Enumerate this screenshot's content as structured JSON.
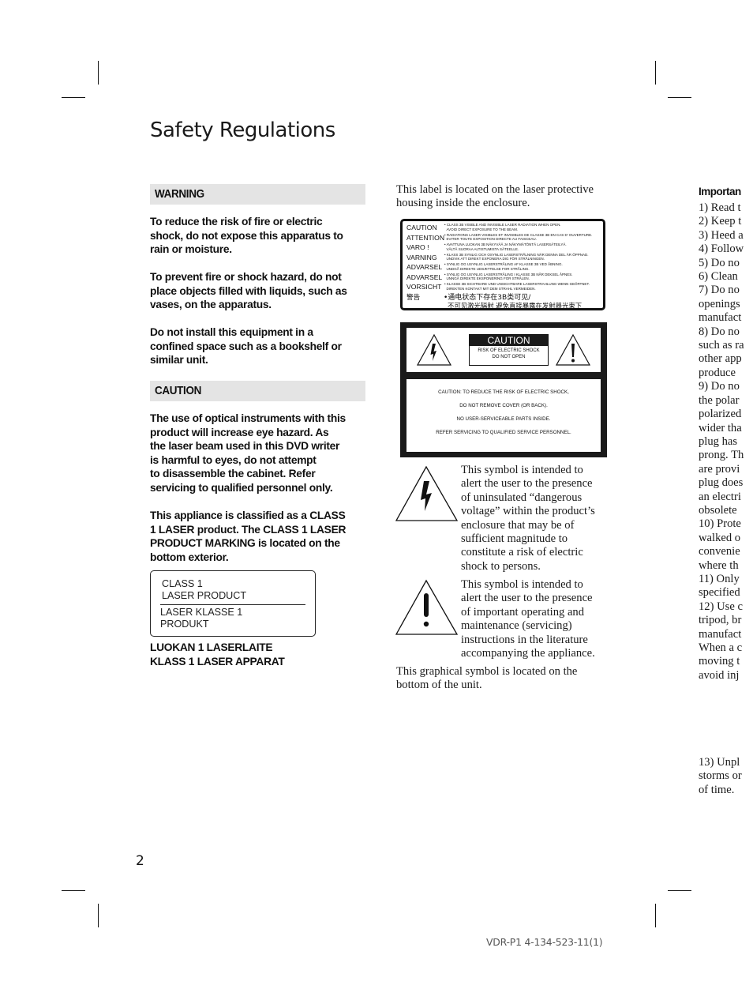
{
  "page": {
    "title": "Safety Regulations",
    "page_number": "2",
    "doc_code": "VDR-P1 4-134-523-11(1)"
  },
  "left_column": {
    "warning": {
      "heading": "WARNING",
      "paragraphs": [
        [
          "To reduce the risk of fire or electric",
          "shock, do not expose this apparatus to",
          "rain or moisture."
        ],
        [
          "To prevent fire or shock hazard, do not",
          "place objects filled with liquids, such as",
          "vases, on the apparatus."
        ],
        [
          "Do not install this equipment in a",
          "confined space such as a bookshelf or",
          "similar unit."
        ]
      ]
    },
    "caution": {
      "heading": "CAUTION",
      "paragraphs": [
        [
          "The use of optical instruments with this",
          "product will increase eye hazard. As",
          "the laser beam used in this DVD writer",
          "is harmful to eyes, do not attempt",
          "to disassemble the cabinet. Refer",
          "servicing to qualified personnel only."
        ],
        [
          "This appliance is classified as a CLASS",
          "1 LASER product. The CLASS 1 LASER",
          "PRODUCT MARKING is located on the",
          "bottom exterior."
        ]
      ]
    },
    "class_label": {
      "line1": "CLASS 1",
      "line2": "LASER PRODUCT",
      "line3": "LASER KLASSE 1",
      "line4": "PRODUKT"
    },
    "class_footer": [
      "LUOKAN 1 LASERLAITE",
      "KLASS 1 LASER APPARAT"
    ]
  },
  "middle_column": {
    "intro": [
      "This label is located on the laser protective",
      "housing inside the enclosure."
    ],
    "laser_label": {
      "rows": [
        {
          "lang": "CAUTION",
          "text": [
            "CLASS 3B VISIBLE AND INVISIBLE LASER RADIATION WHEN OPEN.",
            "AVOID DIRECT EXPOSURE TO THE BEAM."
          ]
        },
        {
          "lang": "ATTENTION",
          "text": [
            "RADIATIONS LASER VISIBLES ET INVISIBLES DE CLASSE 3B EN CAS D' OUVERTURE.",
            "EVITER TOUTE EXPOSITION DIRECTE AU FAISCEAU."
          ]
        },
        {
          "lang": "VARO !",
          "text": [
            "AVATTUNA LUOKAN 3B NÄKYVÄÄ JA NÄKYMÄTÖNTÄ LASERSÄTEILYÄ.",
            "VÄLTÄ SUORAA ALTISTUMISTA SÄTEELLE."
          ]
        },
        {
          "lang": "VARNING",
          "text": [
            "KLASS 3B SYNLIG OCH OSYNLIG LASERSTRÅLNING NÄR DENNA DEL ÄR ÖPPNAD.",
            "UNDVIK ATT DIREKT EXPONERA DIG FÖR STRÅLNINGEN."
          ]
        },
        {
          "lang": "ADVARSEL",
          "text": [
            "SYNLIG OG USYNLIG LASERSTRÅLING AF KLASSE 3B VED ÅBNING.",
            "UNDGÅ DIREKTE UDSÆTTELSE FOR STRÅLING."
          ]
        },
        {
          "lang": "ADVARSEL",
          "text": [
            "SYNLIG OG USYNLIG LASERSTRÅLING I KLASSE 3B NÅR DEKSEL ÅPNES.",
            "UNNGÅ DIREKTE EKSPONERING FOR STRÅLEN."
          ]
        },
        {
          "lang": "VORSICHT",
          "text": [
            "KLASSE 3B SICHTBARE UND UNSICHTBARE LASERSTRAHLUNG WENN GEÖFFNET.",
            "DIREKTEN KONTAKT MIT DEM STRAHL VERMEIDEN."
          ]
        }
      ],
      "cn_lang": "警告",
      "cn_text": [
        "•通电状态下存在3B类可见/",
        "不可见激光辐射 避免直接暴露在发射器光束下"
      ]
    },
    "caution_panel": {
      "badge": "CAUTION",
      "badge_sub": [
        "RISK OF ELECTRIC SHOCK",
        "DO NOT OPEN"
      ],
      "lines": [
        "CAUTION: TO REDUCE THE RISK OF ELECTRIC SHOCK,",
        "DO NOT REMOVE COVER (OR BACK).",
        "NO USER-SERVICEABLE PARTS INSIDE.",
        "REFER SERVICING TO QUALIFIED SERVICE PERSONNEL."
      ]
    },
    "symbol_lightning": [
      "This symbol is intended to",
      "alert the user to the presence",
      "of uninsulated “dangerous",
      "voltage” within the product’s",
      "enclosure that may be of",
      "sufficient magnitude to",
      "constitute a risk of electric",
      "shock to persons."
    ],
    "symbol_exclamation": [
      "This symbol is intended to",
      "alert the user to the presence",
      "of important operating and",
      "maintenance (servicing)",
      "instructions in the literature",
      "accompanying the appliance."
    ],
    "footer": [
      "This graphical symbol is located on the",
      "bottom of the unit."
    ]
  },
  "right_column": {
    "heading": "Importan",
    "lines": [
      "1) Read t",
      "2) Keep t",
      "3) Heed a",
      "4) Follow",
      "5) Do no",
      "6) Clean",
      "7) Do no",
      "openings",
      "manufact",
      "8) Do no",
      "such as ra",
      "other app",
      "produce",
      "9) Do no",
      "the polar",
      "polarized",
      "wider tha",
      "plug has",
      "prong. Th",
      "are provi",
      "plug does",
      "an electri",
      "obsolete",
      "10) Prote",
      "walked o",
      "convenie",
      "where th",
      "11) Only",
      "specified",
      "12) Use c",
      "tripod, br",
      "manufact",
      "When a c",
      "moving t",
      "avoid inj"
    ],
    "tail_lines": [
      "13) Unpl",
      "storms or",
      "of time."
    ]
  }
}
